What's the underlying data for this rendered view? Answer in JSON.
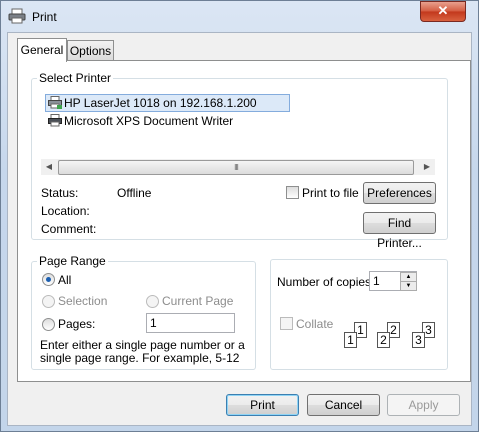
{
  "window": {
    "title": "Print",
    "close_label": "✕"
  },
  "tabs": [
    {
      "label": "General"
    },
    {
      "label": "Options"
    }
  ],
  "select_printer": {
    "legend": "Select Printer",
    "printers": [
      {
        "name": "HP LaserJet 1018 on 192.168.1.200",
        "icon": "network-printer-icon",
        "selected": true
      },
      {
        "name": "Microsoft XPS Document Writer",
        "icon": "printer-icon",
        "selected": false
      }
    ],
    "scroll_thumb_grip": "III",
    "status_label": "Status:",
    "status_value": "Offline",
    "location_label": "Location:",
    "location_value": "",
    "comment_label": "Comment:",
    "comment_value": "",
    "print_to_file_label": "Print to file",
    "print_to_file_checked": false,
    "preferences_label": "Preferences",
    "find_printer_label": "Find Printer..."
  },
  "page_range": {
    "legend": "Page Range",
    "all_label": "All",
    "selection_label": "Selection",
    "current_page_label": "Current Page",
    "pages_label": "Pages:",
    "pages_value": "1",
    "selected_option": "All",
    "hint": "Enter either a single page number or a single page range.  For example, 5-12"
  },
  "copies": {
    "label": "Number of copies:",
    "value": "1",
    "collate_label": "Collate",
    "collate_checked": false,
    "collate_pages": [
      "1",
      "1",
      "2",
      "2",
      "3",
      "3"
    ]
  },
  "footer": {
    "print_label": "Print",
    "cancel_label": "Cancel",
    "apply_label": "Apply"
  },
  "colors": {
    "selection_bg": "#dce9f8",
    "selection_border": "#84acdd",
    "accent": "#3c7fb1",
    "close_button": "#c2371c"
  }
}
